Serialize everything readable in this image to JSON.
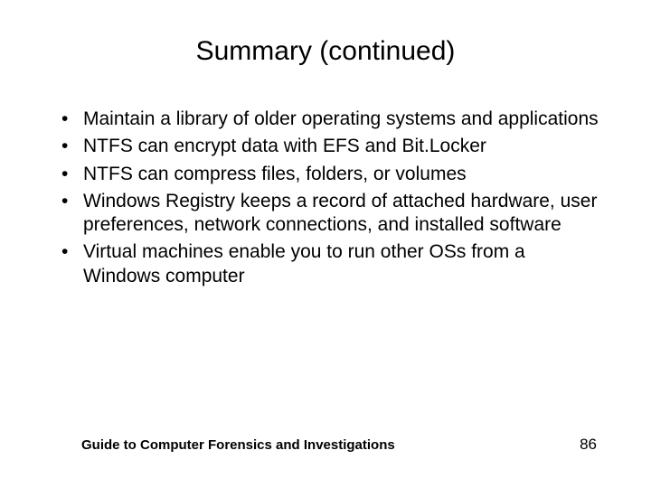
{
  "title": "Summary (continued)",
  "bullets": [
    "Maintain a library of older operating systems and applications",
    "NTFS can encrypt data with EFS and Bit.Locker",
    "NTFS can compress files, folders, or volumes",
    "Windows Registry keeps a record of attached hardware, user preferences, network connections, and installed software",
    "Virtual machines enable you to run other OSs from a Windows computer"
  ],
  "footer": {
    "text": "Guide to Computer Forensics and Investigations",
    "page": "86"
  }
}
